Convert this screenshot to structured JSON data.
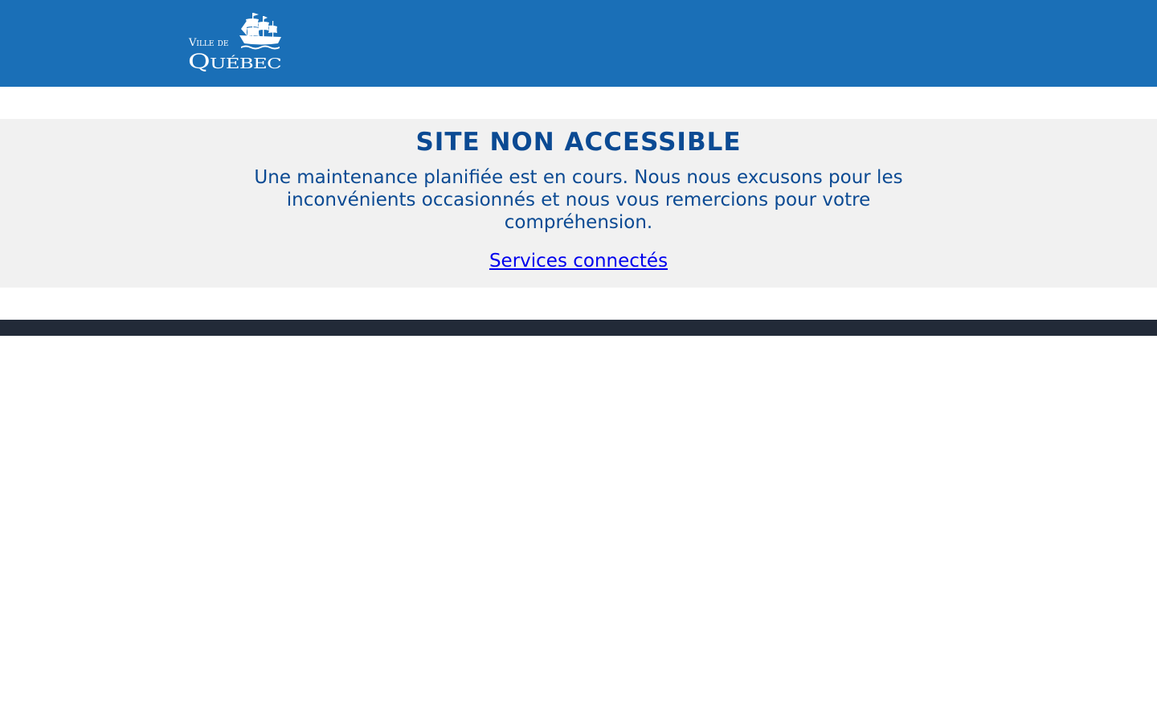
{
  "header": {
    "logo": {
      "icon": "ship-logo-icon",
      "line1": "Ville de",
      "line2": "Québec"
    }
  },
  "banner": {
    "title": "SITE NON ACCESSIBLE",
    "message": "Une maintenance planifiée est en cours. Nous nous excusons pour les inconvénients occasionnés et nous vous remercions pour votre compréhension.",
    "link_label": "Services connectés"
  },
  "colors": {
    "header_bg": "#1a6fb7",
    "banner_bg": "#f1f1f1",
    "title_text": "#0b4a93",
    "link": "#0000ee",
    "footer_bg": "#222a38"
  }
}
